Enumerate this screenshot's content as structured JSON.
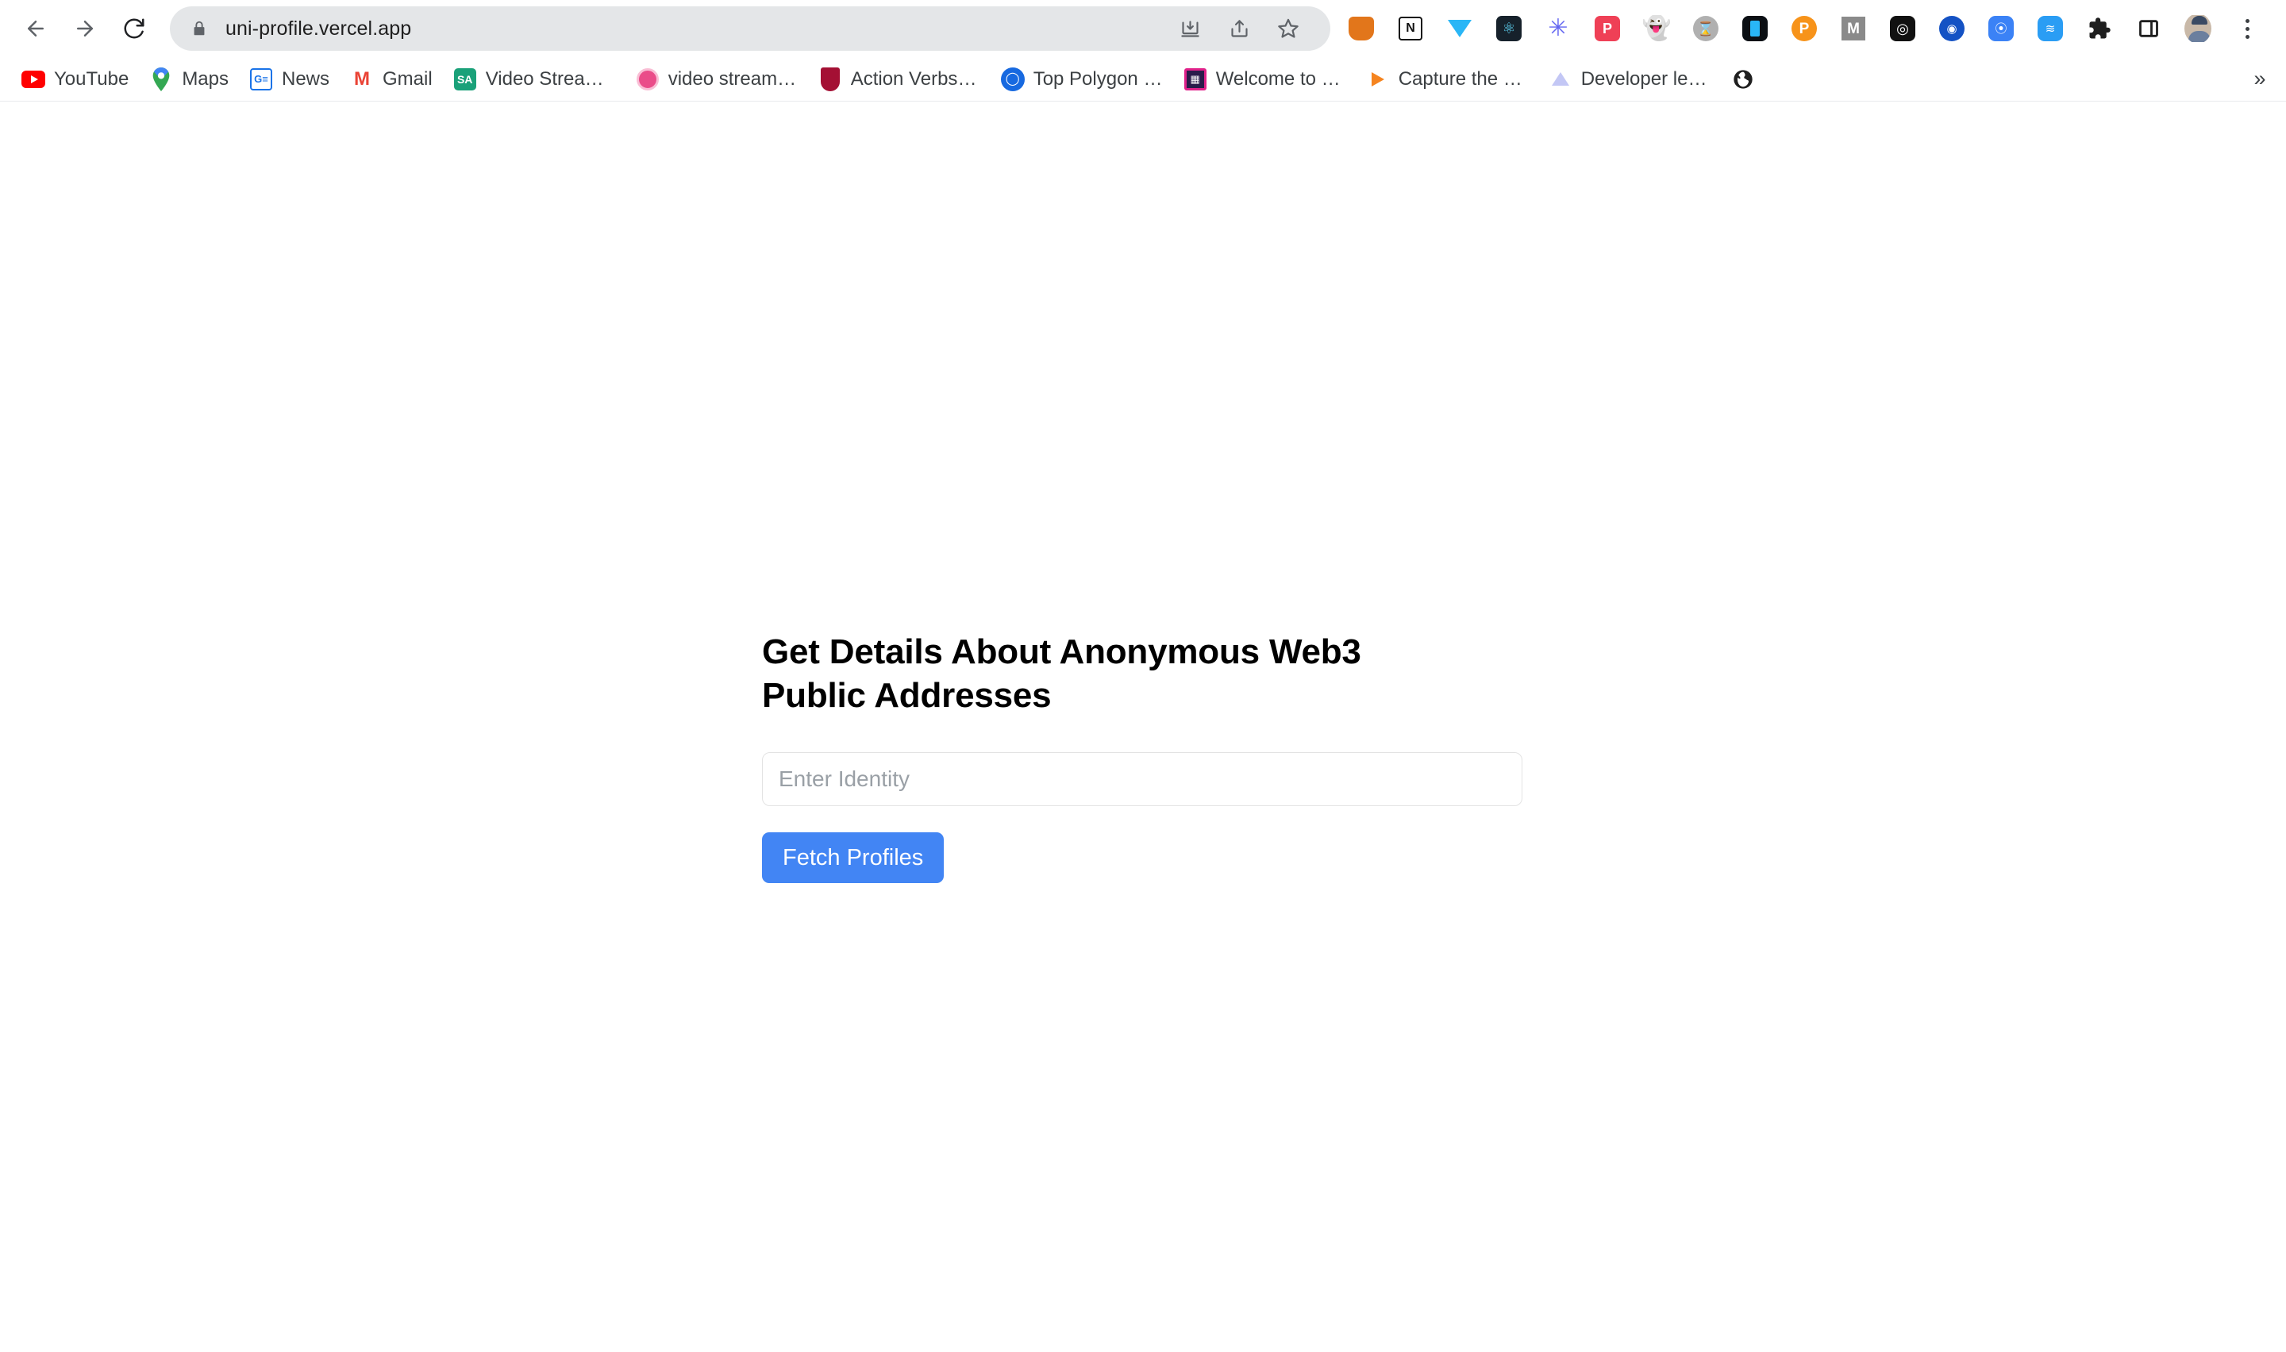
{
  "browser": {
    "nav": {
      "back_label": "Back",
      "forward_label": "Forward",
      "reload_label": "Reload"
    },
    "omnibox": {
      "url": "uni-profile.vercel.app",
      "lock_icon": "lock-icon",
      "actions": [
        {
          "name": "install-page-icon",
          "label": "Install"
        },
        {
          "name": "share-icon",
          "label": "Share"
        },
        {
          "name": "bookmark-star-icon",
          "label": "Bookmark"
        }
      ]
    },
    "extensions": [
      {
        "name": "metamask-icon",
        "title": "MetaMask"
      },
      {
        "name": "notion-icon",
        "title": "Notion",
        "glyph": "N"
      },
      {
        "name": "diamond-icon",
        "title": "Diamond"
      },
      {
        "name": "react-devtools-icon",
        "title": "React Developer Tools",
        "glyph": "⚛"
      },
      {
        "name": "asterisk-icon",
        "title": "Asterisk",
        "glyph": "✳"
      },
      {
        "name": "pocket-icon",
        "title": "Pocket",
        "glyph": "P"
      },
      {
        "name": "phantom-wallet-icon",
        "title": "Phantom",
        "glyph": "●"
      },
      {
        "name": "hourglass-icon",
        "title": "Hourglass",
        "glyph": "⧖"
      },
      {
        "name": "dark-app-icon",
        "title": "App"
      },
      {
        "name": "polkadot-icon",
        "title": "Polkadot",
        "glyph": "P"
      },
      {
        "name": "medium-icon",
        "title": "Medium",
        "glyph": "M"
      },
      {
        "name": "openai-icon",
        "title": "OpenAI",
        "glyph": "◎"
      },
      {
        "name": "blue-target-icon",
        "title": "Target",
        "glyph": "◉"
      },
      {
        "name": "blue-compass-icon",
        "title": "Compass",
        "glyph": "⦿"
      },
      {
        "name": "blue-wave-icon",
        "title": "Wave",
        "glyph": "≋"
      }
    ],
    "toolbar_end": {
      "extensions_puzzle": "extensions-puzzle-icon",
      "side_panel": "side-panel-icon",
      "avatar": "profile-avatar",
      "menu": "chrome-menu-icon"
    },
    "bookmarks": [
      {
        "label": "YouTube",
        "icon": "youtube-icon"
      },
      {
        "label": "Maps",
        "icon": "google-maps-icon"
      },
      {
        "label": "News",
        "icon": "google-news-icon"
      },
      {
        "label": "Gmail",
        "icon": "gmail-icon"
      },
      {
        "label": "Video Streaming...",
        "icon": "sa-icon"
      },
      {
        "label": "video streaming w...",
        "icon": "dribbble-icon"
      },
      {
        "label": "Action Verbs | Har...",
        "icon": "harvard-icon"
      },
      {
        "label": "Top Polygon Dapp...",
        "icon": "polygon-icon"
      },
      {
        "label": "Welcome to NFT...",
        "icon": "nft-icon"
      },
      {
        "label": "Capture the Ether...",
        "icon": "flag-icon"
      },
      {
        "label": "Developer learnin...",
        "icon": "ethereum-icon"
      },
      {
        "label": "",
        "icon": "globe-icon"
      }
    ],
    "bookmarks_overflow": "»"
  },
  "page": {
    "headline": "Get Details About Anonymous Web3 Public Addresses",
    "identity_input": {
      "placeholder": "Enter Identity",
      "value": ""
    },
    "fetch_button_label": "Fetch Profiles",
    "colors": {
      "accent": "#4285f4",
      "text": "#000000",
      "placeholder": "#9aa0a6",
      "input_border": "#e3e3e3"
    }
  }
}
